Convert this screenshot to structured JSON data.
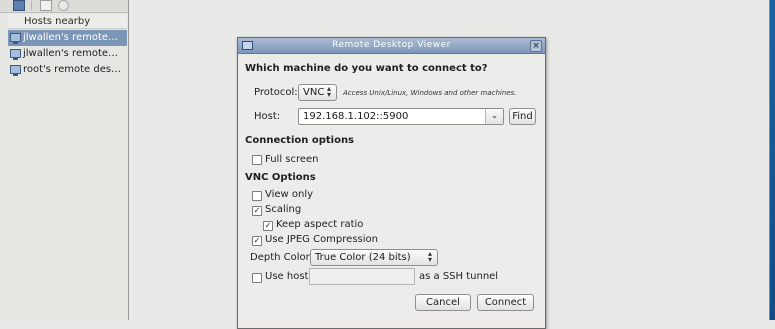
{
  "sidebar": {
    "header": "Hosts nearby",
    "hosts": [
      {
        "label": "jlwallen's remote…",
        "selected": true
      },
      {
        "label": "jlwallen's remote…",
        "selected": false
      },
      {
        "label": "root's remote des…",
        "selected": false
      }
    ],
    "toolbar_icons": [
      "bookmark-icon",
      "edit-icon",
      "delete-icon"
    ]
  },
  "dialog": {
    "title": "Remote Desktop Viewer",
    "question": "Which machine do you want to connect to?",
    "protocol_label": "Protocol:",
    "protocol_value": "VNC",
    "protocol_note": "Access Unix/Linux, Windows and other machines.",
    "host_label": "Host:",
    "host_value": "192.168.1.102::5900",
    "find_label": "Find",
    "connection_options_heading": "Connection options",
    "full_screen_label": "Full screen",
    "full_screen_checked": false,
    "vnc_options_heading": "VNC Options",
    "view_only_label": "View only",
    "view_only_checked": false,
    "scaling_label": "Scaling",
    "scaling_checked": true,
    "keep_aspect_label": "Keep aspect ratio",
    "keep_aspect_checked": true,
    "jpeg_label": "Use JPEG Compression",
    "jpeg_checked": true,
    "depth_label": "Depth Color:",
    "depth_value": "True Color (24 bits)",
    "use_host_label": "Use host",
    "use_host_checked": false,
    "ssh_tunnel_label": "as a SSH tunnel",
    "cancel_label": "Cancel",
    "connect_label": "Connect"
  },
  "colors": {
    "selection": "#7b96b6",
    "titlebar": "#7e97b8",
    "desktop_edge": "#1b62a6"
  }
}
